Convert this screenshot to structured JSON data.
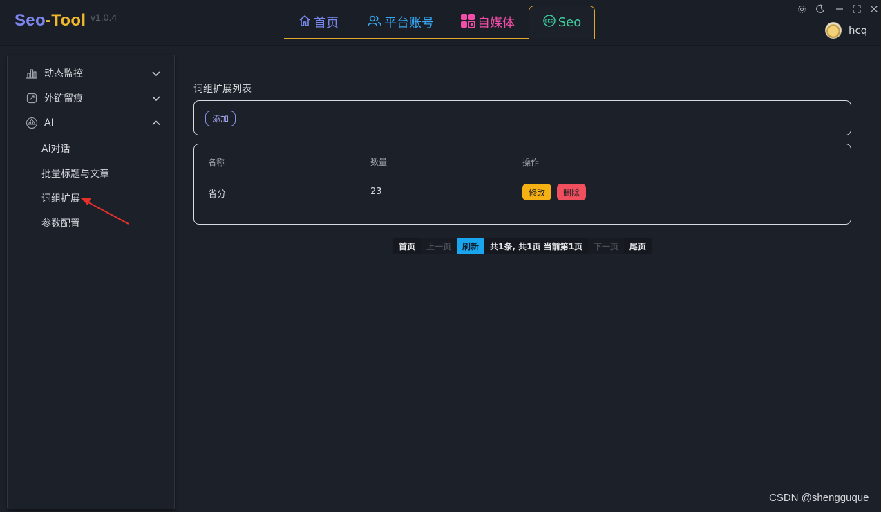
{
  "app": {
    "logo_seo": "Seo",
    "logo_dash": "-",
    "logo_tool": "Tool",
    "version": "v1.0.4"
  },
  "tabs": [
    {
      "label": "首页",
      "icon": "home-icon",
      "color": "#7a89f0"
    },
    {
      "label": "平台账号",
      "icon": "users-icon",
      "color": "#37a6f0"
    },
    {
      "label": "自媒体",
      "icon": "grid-icon",
      "color": "#f24da8"
    },
    {
      "label": "Seo",
      "icon": "seo-icon",
      "color": "#3fd1a2",
      "active": true
    }
  ],
  "window_controls": [
    "settings-icon",
    "moon-icon",
    "minimize-icon",
    "maximize-icon",
    "close-icon"
  ],
  "user": {
    "name": "hcq"
  },
  "sidebar": {
    "items": [
      {
        "label": "动态监控",
        "icon": "chart-icon",
        "expanded": false
      },
      {
        "label": "外链留痕",
        "icon": "link-icon",
        "expanded": false
      },
      {
        "label": "AI",
        "icon": "ai-icon",
        "expanded": true
      }
    ],
    "sub_items": [
      "Ai对话",
      "批量标题与文章",
      "词组扩展",
      "参数配置"
    ]
  },
  "main": {
    "title": "词组扩展列表",
    "add_label": "添加",
    "columns": [
      "名称",
      "数量",
      "操作"
    ],
    "rows": [
      {
        "name": "省分",
        "count": "23",
        "edit_label": "修改",
        "delete_label": "删除"
      }
    ]
  },
  "pager": {
    "first": "首页",
    "prev": "上一页",
    "refresh": "刷新",
    "info": "共1条, 共1页 当前第1页",
    "next": "下一页",
    "last": "尾页"
  },
  "watermark": "CSDN @shengguque",
  "colors": {
    "accent": "#e0a92c",
    "background": "#1c2129",
    "edit": "#f5b014",
    "delete": "#f0505e",
    "refresh": "#1aa6ee"
  }
}
